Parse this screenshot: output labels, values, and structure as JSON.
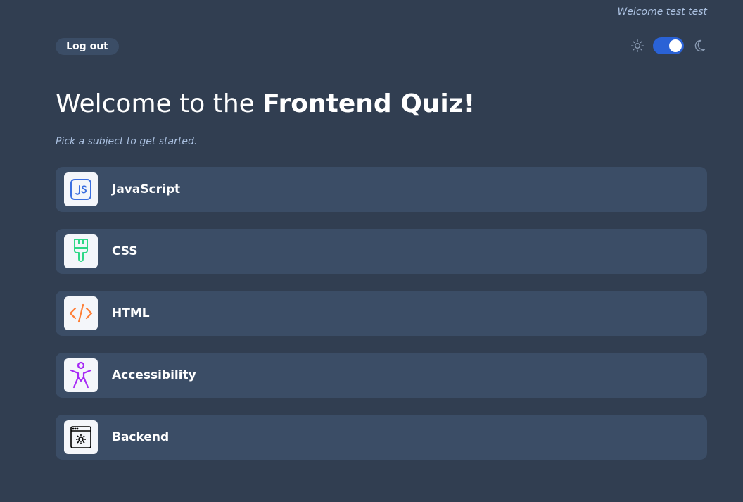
{
  "header": {
    "welcome_user": "Welcome test test",
    "logout_label": "Log out",
    "theme": {
      "dark_mode_enabled": true,
      "light_icon": "sun-icon",
      "dark_icon": "moon-icon"
    }
  },
  "main": {
    "title_prefix": "Welcome to the ",
    "title_bold": "Frontend Quiz!",
    "subtitle": "Pick a subject to get started."
  },
  "subjects": [
    {
      "label": "JavaScript",
      "icon": "javascript-icon",
      "color": "#3b6fe0"
    },
    {
      "label": "CSS",
      "icon": "paintbrush-icon",
      "color": "#2fd887"
    },
    {
      "label": "HTML",
      "icon": "code-icon",
      "color": "#ff7e35"
    },
    {
      "label": "Accessibility",
      "icon": "accessibility-icon",
      "color": "#a729f5"
    },
    {
      "label": "Backend",
      "icon": "backend-settings-icon",
      "color": "#000000"
    }
  ],
  "colors": {
    "background": "#313e51",
    "card": "#3b4d66",
    "muted_text": "#abc1e1",
    "toggle": "#2a62d6"
  }
}
